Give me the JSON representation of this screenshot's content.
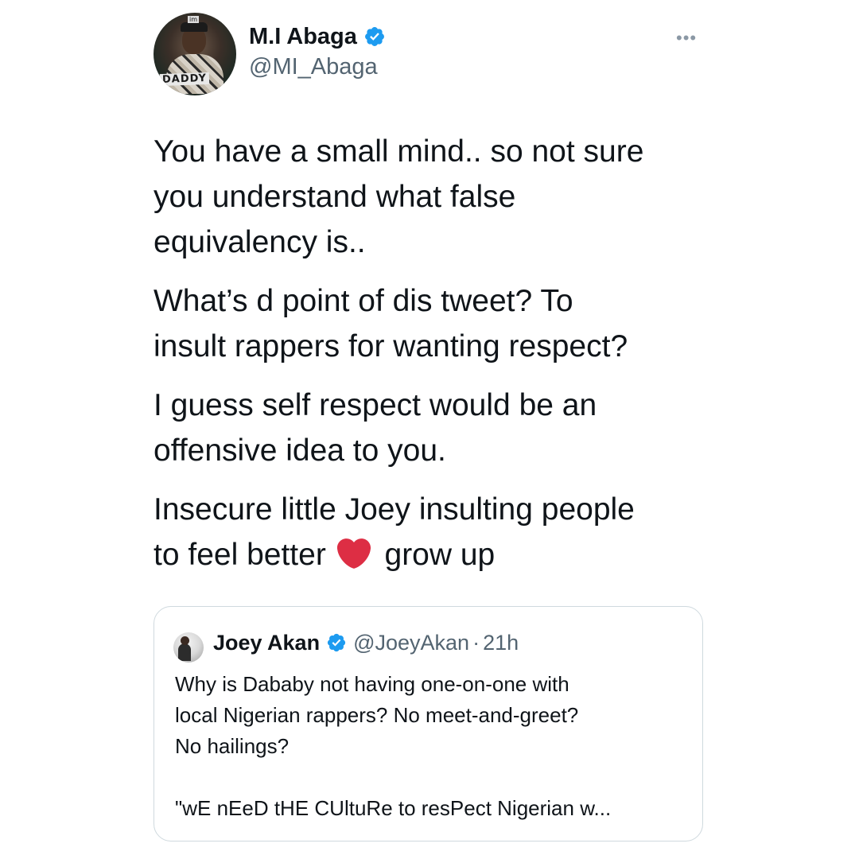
{
  "author": {
    "display_name": "M.I Abaga",
    "handle": "@MI_Abaga",
    "avatar_badge": "DADDY",
    "avatar_mark": "im"
  },
  "more_label": "•••",
  "tweet": {
    "paragraphs": [
      "You have a small mind.. so not sure\nyou understand what false\nequivalency is..",
      "What’s d point of dis tweet? To\ninsult rappers for wanting respect?",
      "I guess self respect would be an\noffensive idea to you."
    ],
    "last_line_1": "Insecure little Joey insulting people",
    "last_line_2_before": "to feel better",
    "last_line_2_after": "grow up",
    "emoji": "red-heart"
  },
  "quoted_tweet": {
    "display_name": "Joey Akan",
    "handle": "@JoeyAkan",
    "separator": "·",
    "time": "21h",
    "line_1": "Why is Dababy not having one-on-one with",
    "line_2": "local Nigerian rappers?  No meet-and-greet?",
    "line_3": "No hailings?",
    "line_4": "\"wE nEeD tHE CUltuRe to resPect Nigerian w..."
  },
  "colors": {
    "verified_blue": "#1d9bf0",
    "secondary_text": "#536471",
    "border": "#cfd9de",
    "heart_red": "#dd2e44"
  }
}
